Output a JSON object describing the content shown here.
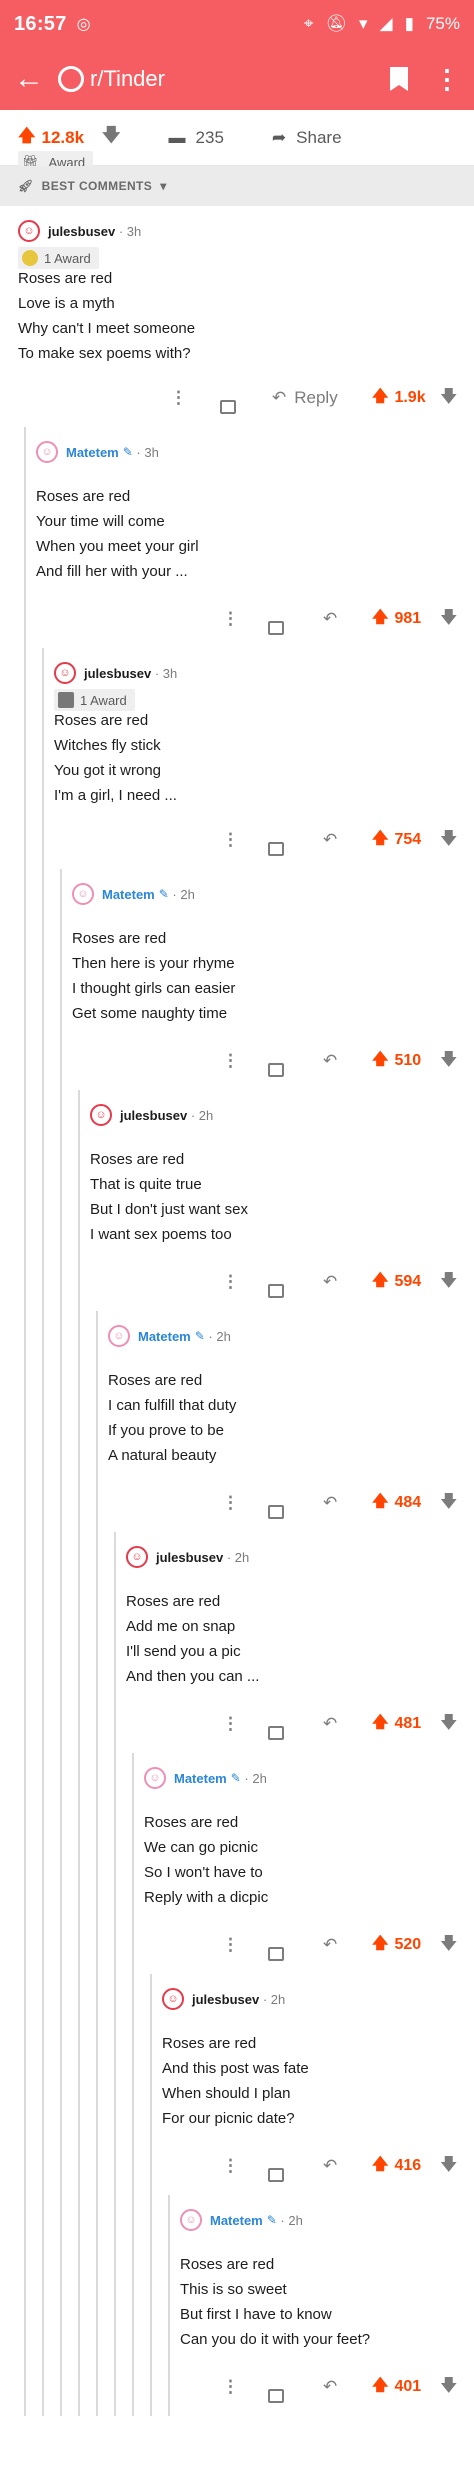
{
  "status": {
    "time": "16:57",
    "battery": "75%"
  },
  "toolbar": {
    "subreddit": "r/Tinder"
  },
  "post": {
    "score": "12.8k",
    "comments": "235",
    "share": "Share",
    "award": "Award"
  },
  "sort": {
    "label": "BEST COMMENTS"
  },
  "reply_label": "Reply",
  "comments": [
    {
      "author": "julesbusev",
      "time": "3h",
      "award": "1 Award",
      "score": "1.9k",
      "lines": [
        "Roses are red",
        "Love is a myth",
        "Why can't I meet someone",
        "To make sex poems with?"
      ]
    },
    {
      "author": "Matetem",
      "time": "3h",
      "score": "981",
      "lines": [
        "Roses are red",
        "Your time will come",
        "When you meet your girl",
        "And fill her with your ..."
      ]
    },
    {
      "author": "julesbusev",
      "time": "3h",
      "award": "1 Award",
      "score": "754",
      "lines": [
        "Roses are red",
        "Witches fly stick",
        "You got it wrong",
        "I'm a girl, I need ..."
      ]
    },
    {
      "author": "Matetem",
      "time": "2h",
      "score": "510",
      "lines": [
        "Roses are red",
        "Then here is your rhyme",
        "I thought girls can easier",
        "Get some naughty time"
      ]
    },
    {
      "author": "julesbusev",
      "time": "2h",
      "score": "594",
      "lines": [
        "Roses are red",
        "That is quite true",
        "But I don't just want sex",
        "I want sex poems too"
      ]
    },
    {
      "author": "Matetem",
      "time": "2h",
      "score": "484",
      "lines": [
        "Roses are red",
        "I can fulfill that duty",
        "If you prove to be",
        "A natural beauty"
      ]
    },
    {
      "author": "julesbusev",
      "time": "2h",
      "score": "481",
      "lines": [
        "Roses are red",
        "Add me on snap",
        "I'll send you a pic",
        "And then you can ..."
      ]
    },
    {
      "author": "Matetem",
      "time": "2h",
      "score": "520",
      "lines": [
        "Roses are red",
        "We can go picnic",
        "So I won't have to",
        "Reply with a dicpic"
      ]
    },
    {
      "author": "julesbusev",
      "time": "2h",
      "score": "416",
      "lines": [
        "Roses are red",
        "And this post was fate",
        "When should I plan",
        "For our picnic date?"
      ]
    },
    {
      "author": "Matetem",
      "time": "2h",
      "score": "401",
      "lines": [
        "Roses are red",
        "This is so sweet",
        "But first I have to know",
        "Can you do it with your feet?"
      ]
    }
  ]
}
